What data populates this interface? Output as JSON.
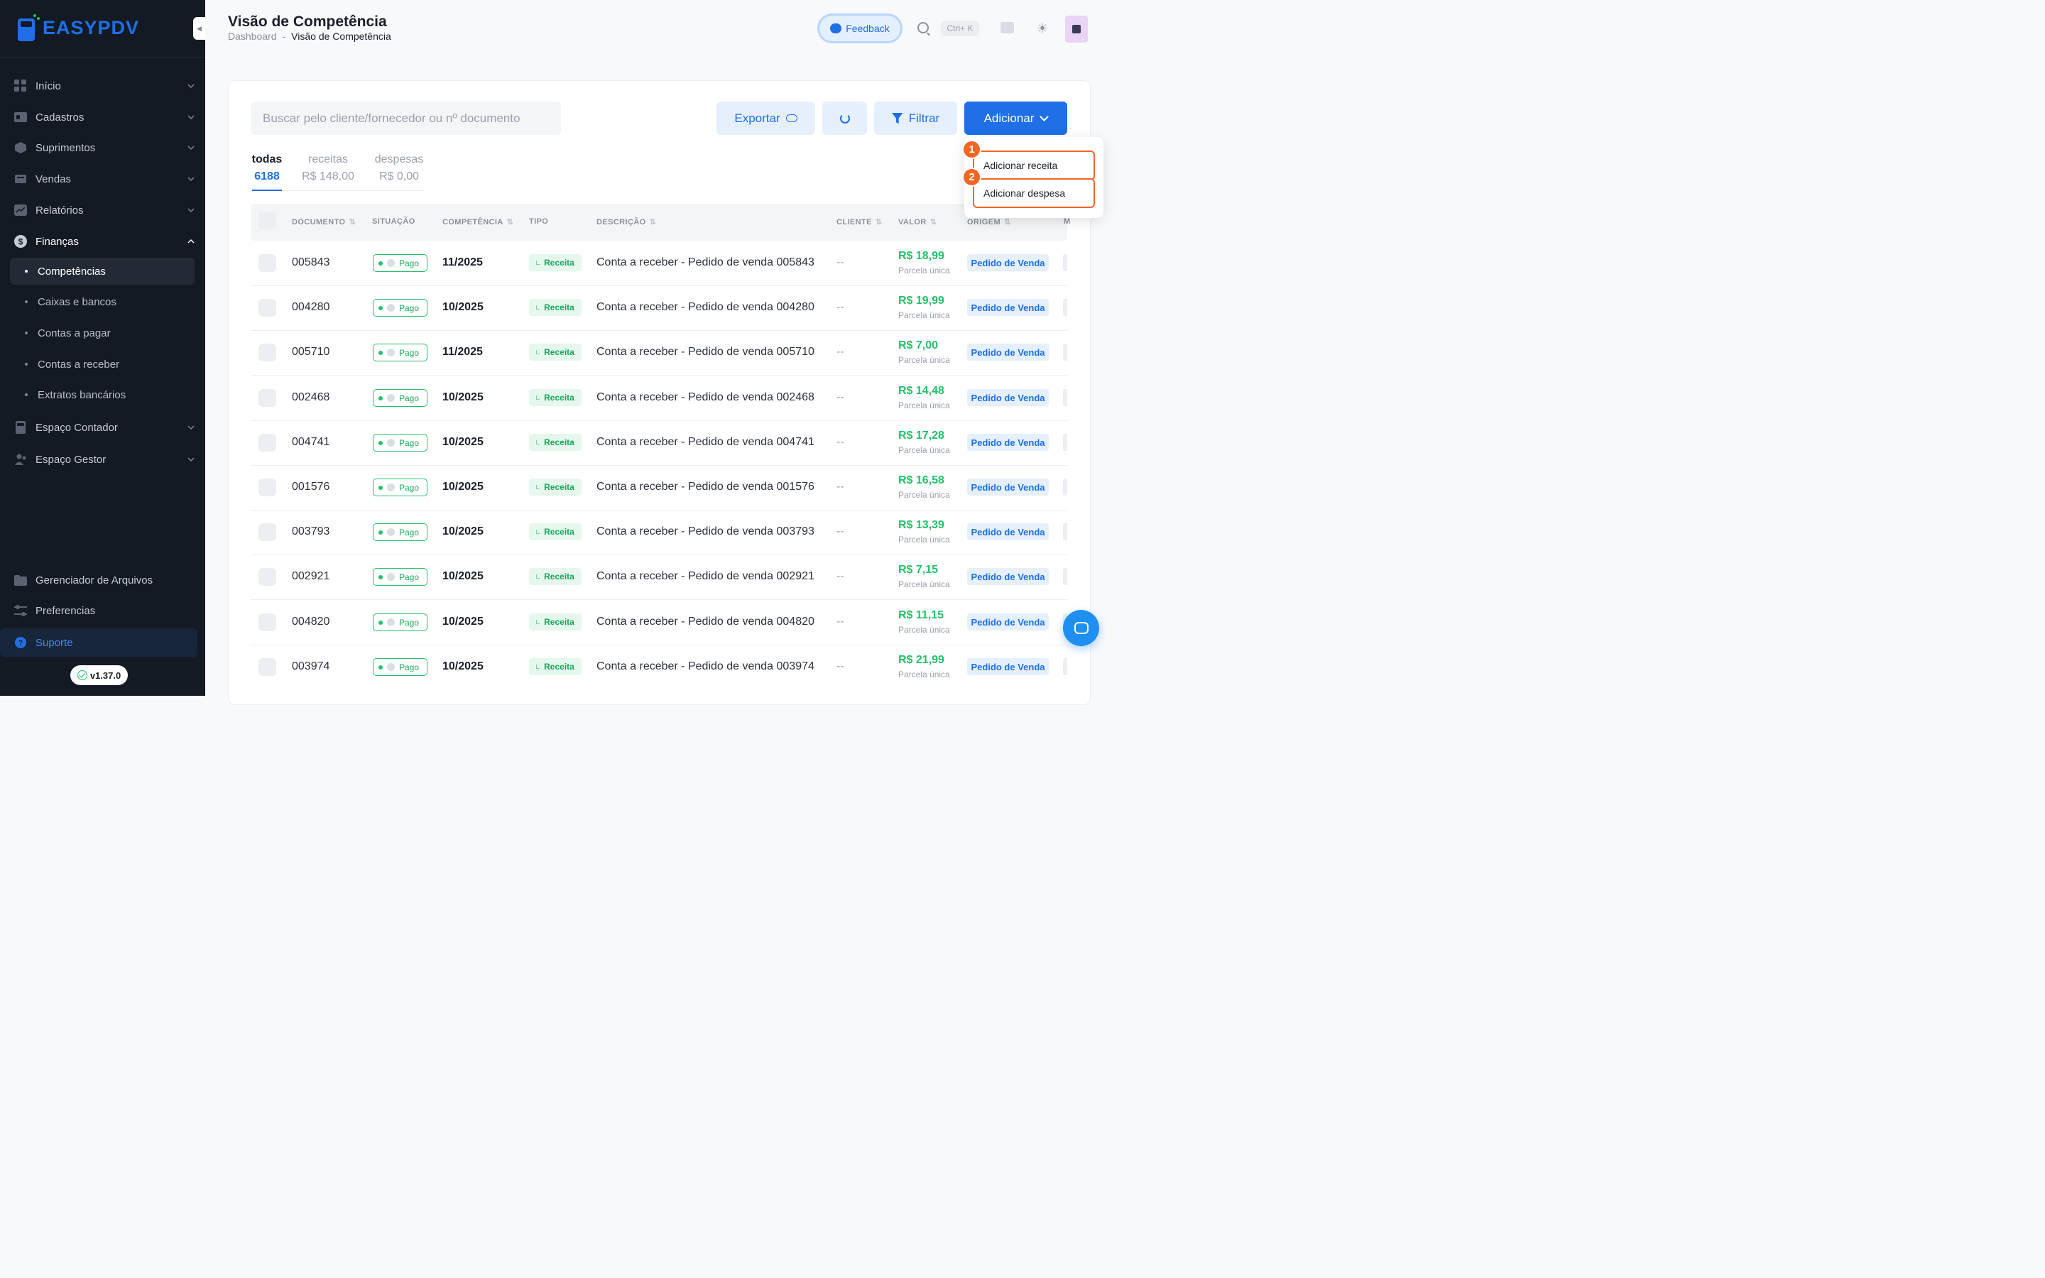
{
  "sidebar": {
    "logo": "EASYPDV",
    "items": [
      {
        "label": "Início"
      },
      {
        "label": "Cadastros"
      },
      {
        "label": "Suprimentos"
      },
      {
        "label": "Vendas"
      },
      {
        "label": "Relatórios"
      },
      {
        "label": "Finanças"
      }
    ],
    "finance_sub": [
      {
        "label": "Competências"
      },
      {
        "label": "Caixas e bancos"
      },
      {
        "label": "Contas a pagar"
      },
      {
        "label": "Contas a receber"
      },
      {
        "label": "Extratos bancários"
      }
    ],
    "items_after": [
      {
        "label": "Espaço Contador"
      },
      {
        "label": "Espaço Gestor"
      }
    ],
    "bottom": [
      {
        "label": "Gerenciador de Arquivos"
      },
      {
        "label": "Preferencias"
      },
      {
        "label": "Suporte"
      }
    ],
    "version": "v1.37.0"
  },
  "header": {
    "title": "Visão de Competência",
    "breadcrumb_root": "Dashboard",
    "breadcrumb_sep": "-",
    "breadcrumb_current": "Visão de Competência",
    "feedback": "Feedback",
    "shortcut": "Ctrl+ K"
  },
  "toolbar": {
    "search_placeholder": "Buscar pelo cliente/fornecedor ou nº documento",
    "export": "Exportar",
    "filter": "Filtrar",
    "add": "Adicionar"
  },
  "tabs": [
    {
      "label": "todas",
      "value": "6188"
    },
    {
      "label": "receitas",
      "value": "R$ 148,00"
    },
    {
      "label": "despesas",
      "value": "R$ 0,00"
    }
  ],
  "table": {
    "columns": [
      "DOCUMENTO",
      "SITUAÇÃO",
      "COMPETÊNCIA",
      "TIPO",
      "DESCRIÇÃO",
      "CLIENTE",
      "VALOR",
      "ORIGEM",
      "M"
    ],
    "rows": [
      {
        "doc": "005843",
        "status": "Pago",
        "comp": "11/2025",
        "tipo": "Receita",
        "desc": "Conta a receber - Pedido de venda 005843",
        "cliente": "--",
        "valor": "R$ 18,99",
        "parcela": "Parcela única",
        "origem": "Pedido de Venda"
      },
      {
        "doc": "004280",
        "status": "Pago",
        "comp": "10/2025",
        "tipo": "Receita",
        "desc": "Conta a receber - Pedido de venda 004280",
        "cliente": "--",
        "valor": "R$ 19,99",
        "parcela": "Parcela única",
        "origem": "Pedido de Venda"
      },
      {
        "doc": "005710",
        "status": "Pago",
        "comp": "11/2025",
        "tipo": "Receita",
        "desc": "Conta a receber - Pedido de venda 005710",
        "cliente": "--",
        "valor": "R$ 7,00",
        "parcela": "Parcela única",
        "origem": "Pedido de Venda"
      },
      {
        "doc": "002468",
        "status": "Pago",
        "comp": "10/2025",
        "tipo": "Receita",
        "desc": "Conta a receber - Pedido de venda 002468",
        "cliente": "--",
        "valor": "R$ 14,48",
        "parcela": "Parcela única",
        "origem": "Pedido de Venda"
      },
      {
        "doc": "004741",
        "status": "Pago",
        "comp": "10/2025",
        "tipo": "Receita",
        "desc": "Conta a receber - Pedido de venda 004741",
        "cliente": "--",
        "valor": "R$ 17,28",
        "parcela": "Parcela única",
        "origem": "Pedido de Venda"
      },
      {
        "doc": "001576",
        "status": "Pago",
        "comp": "10/2025",
        "tipo": "Receita",
        "desc": "Conta a receber - Pedido de venda 001576",
        "cliente": "--",
        "valor": "R$ 16,58",
        "parcela": "Parcela única",
        "origem": "Pedido de Venda"
      },
      {
        "doc": "003793",
        "status": "Pago",
        "comp": "10/2025",
        "tipo": "Receita",
        "desc": "Conta a receber - Pedido de venda 003793",
        "cliente": "--",
        "valor": "R$ 13,39",
        "parcela": "Parcela única",
        "origem": "Pedido de Venda"
      },
      {
        "doc": "002921",
        "status": "Pago",
        "comp": "10/2025",
        "tipo": "Receita",
        "desc": "Conta a receber - Pedido de venda 002921",
        "cliente": "--",
        "valor": "R$ 7,15",
        "parcela": "Parcela única",
        "origem": "Pedido de Venda"
      },
      {
        "doc": "004820",
        "status": "Pago",
        "comp": "10/2025",
        "tipo": "Receita",
        "desc": "Conta a receber - Pedido de venda 004820",
        "cliente": "--",
        "valor": "R$ 11,15",
        "parcela": "Parcela única",
        "origem": "Pedido de Venda"
      },
      {
        "doc": "003974",
        "status": "Pago",
        "comp": "10/2025",
        "tipo": "Receita",
        "desc": "Conta a receber - Pedido de venda 003974",
        "cliente": "--",
        "valor": "R$ 21,99",
        "parcela": "Parcela única",
        "origem": "Pedido de Venda"
      }
    ]
  },
  "dropdown": {
    "items": [
      {
        "marker": "1",
        "label": "Adicionar receita"
      },
      {
        "marker": "2",
        "label": "Adicionar despesa"
      }
    ]
  },
  "colors": {
    "primary": "#1f6fe6",
    "success": "#21c26a",
    "highlight": "#f26522",
    "sidebar_bg": "#141a24"
  }
}
